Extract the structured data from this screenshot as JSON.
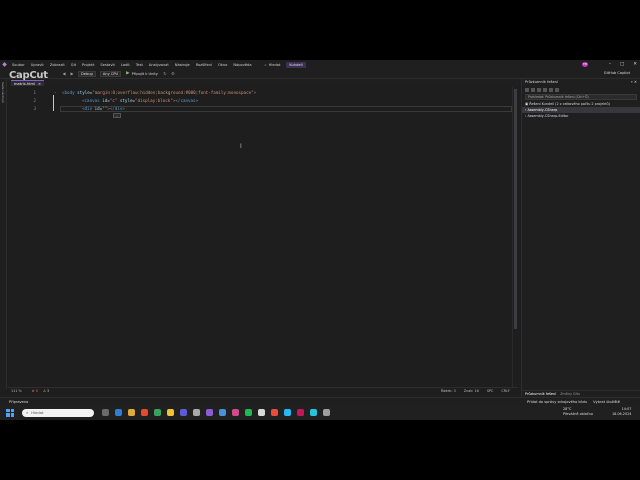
{
  "watermark": "CapCut",
  "menubar": {
    "items": [
      "Soubor",
      "Upravit",
      "Zobrazit",
      "Git",
      "Projekt",
      "Sestavit",
      "Ladit",
      "Test",
      "Analyzovat",
      "Nástroje",
      "Rozšíření",
      "Okno",
      "Nápověda"
    ],
    "search_label": "Hledat",
    "project_name": "Kuhdeli",
    "avatar_initials": "TH"
  },
  "toolbar": {
    "config": "Debug",
    "platform": "Any CPU",
    "attach_label": "Připojit k Unity",
    "copilot_label": "GitHub Copilot"
  },
  "left_strip": {
    "label": "Sada nástrojů"
  },
  "editor": {
    "tab_label": "matrix.html",
    "tab_close": "×",
    "line_numbers": [
      "1",
      "2",
      "3"
    ],
    "lines": {
      "l1": {
        "open": "<",
        "tag": "body",
        "attr": " style",
        "eq": "=",
        "val": "\"margin:0;overflow:hidden;background:#000;font-family:monospace\"",
        "close": ">"
      },
      "l2": {
        "open": "<",
        "tag": "canvas",
        "attr1": " id",
        "eq1": "=",
        "val1": "\"c\"",
        "attr2": " style",
        "eq2": "=",
        "val2": "\"display:block\"",
        "mid": "></",
        "tag_end": "canvas",
        "close": ">"
      },
      "l3": {
        "open": "<",
        "tag": "div",
        "attr": " id",
        "eq": "=",
        "val": "\"\"",
        "mid": "></",
        "tag_end": "div",
        "close": ">"
      }
    },
    "hint": "⌕"
  },
  "edit_status": {
    "zoom": "111 %",
    "errors": "0",
    "warnings": "3",
    "position": "Řádek: 3",
    "column": "Znak: 16",
    "spc": "SPC",
    "eol": "CRLF"
  },
  "solution_explorer": {
    "title": "Průzkumník řešení",
    "search_placeholder": "Prohledat: Průzkumník řešení (Ctrl+Ů)",
    "items": [
      "Řešení Kundeli (2 z celkového počtu 2 projektů)",
      "Assembly-CSharp",
      "Assembly-CSharp-Editor"
    ],
    "tabs": [
      "Průzkumník řešení",
      "Změny Gitu"
    ]
  },
  "statusbar": {
    "ready": "Připraveno",
    "source_control": "Přidat do správy zdrojového kódu",
    "repo": "Vybrat úložiště"
  },
  "taskbar": {
    "search_placeholder": "Hledat",
    "temperature": "28°C",
    "weather": "Převážně oblačno",
    "time": "14:07",
    "date": "18.06.2024"
  },
  "colors": {
    "accent": "#8a5cd6",
    "tag": "#569cd6",
    "attribute": "#9cdcfe",
    "string": "#ce9178"
  }
}
